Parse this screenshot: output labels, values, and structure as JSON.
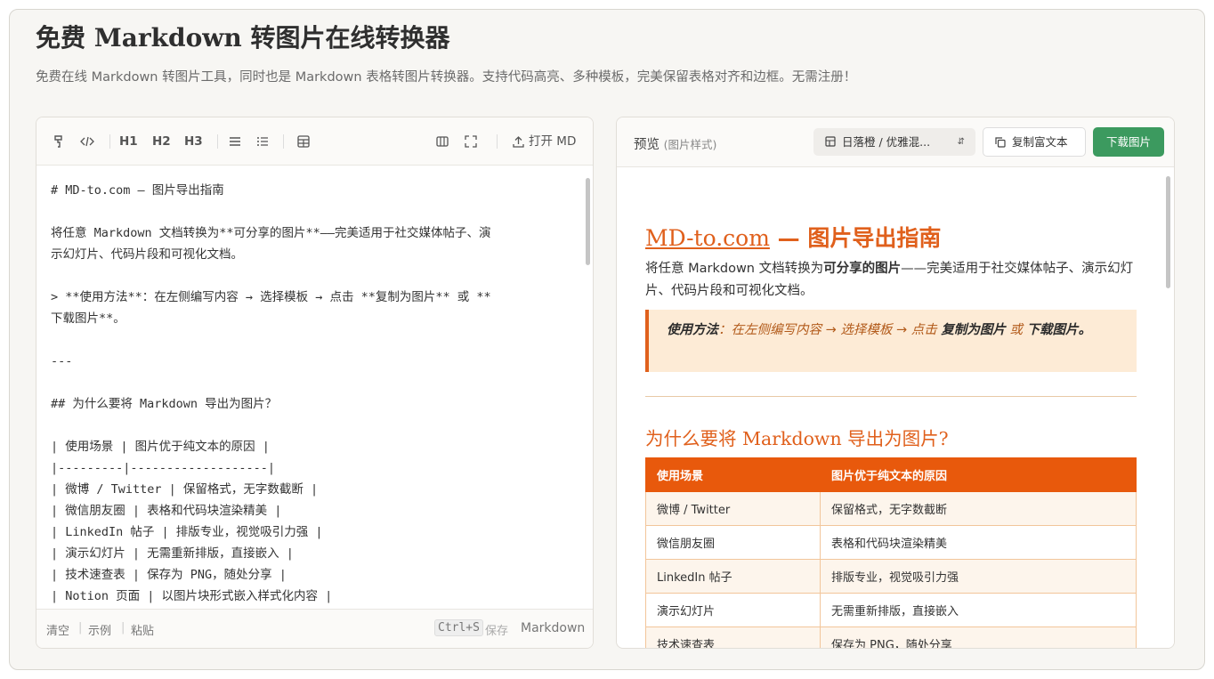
{
  "header": {
    "title": "免费 Markdown 转图片在线转换器",
    "subtitle": "免费在线 Markdown 转图片工具，同时也是 Markdown 表格转图片转换器。支持代码高亮、多种模板，完美保留表格对齐和边框。无需注册！"
  },
  "editor": {
    "toolbar": {
      "h1": "H1",
      "h2": "H2",
      "h3": "H3",
      "open_md": "打开 MD"
    },
    "lines": [
      "# MD-to.com — 图片导出指南",
      "",
      "将任意 Markdown 文档转换为**可分享的图片**——完美适用于社交媒体帖子、演",
      "示幻灯片、代码片段和可视化文档。",
      "",
      "> **使用方法**：在左侧编写内容 → 选择模板 → 点击 **复制为图片** 或 **",
      "下载图片**。",
      "",
      "---",
      "",
      "## 为什么要将 Markdown 导出为图片？",
      "",
      "| 使用场景 | 图片优于纯文本的原因 |",
      "|---------|-------------------|",
      "| 微博 / Twitter | 保留格式，无字数截断 |",
      "| 微信朋友圈 | 表格和代码块渲染精美 |",
      "| LinkedIn 帖子 | 排版专业，视觉吸引力强 |",
      "| 演示幻灯片 | 无需重新排版，直接嵌入 |",
      "| 技术速查表 | 保存为 PNG，随处分享 |",
      "| Notion 页面 | 以图片块形式嵌入样式化内容 |"
    ],
    "footer": {
      "clear": "清空",
      "example": "示例",
      "paste": "粘贴",
      "shortcut": "Ctrl+S",
      "save": "保存",
      "mode": "Markdown"
    }
  },
  "preview": {
    "label": "预览",
    "label_note": "(图片样式)",
    "template_select": "日落橙 / 优雅混...",
    "copy_button": "复制富文本",
    "download_button": "下载图片",
    "content": {
      "h1_link": "MD-to.com",
      "h1_rest": " — 图片导出指南",
      "para_a": "将任意 Markdown 文档转换为",
      "para_bold": "可分享的图片",
      "para_b": "——完美适用于社交媒体帖子、演示幻灯片、代码片段和可视化文档。",
      "quote_bold1": "使用方法",
      "quote_a": "：在左侧编写内容 → 选择模板 → 点击 ",
      "quote_bold2": "复制为图片",
      "quote_b": " 或 ",
      "quote_bold3": "下载图片",
      "quote_end": "。",
      "h2": "为什么要将 Markdown 导出为图片?",
      "table_headers": [
        "使用场景",
        "图片优于纯文本的原因"
      ],
      "table_rows": [
        [
          "微博 / Twitter",
          "保留格式，无字数截断"
        ],
        [
          "微信朋友圈",
          "表格和代码块渲染精美"
        ],
        [
          "LinkedIn 帖子",
          "排版专业，视觉吸引力强"
        ],
        [
          "演示幻灯片",
          "无需重新排版，直接嵌入"
        ],
        [
          "技术速查表",
          "保存为 PNG，随处分享"
        ]
      ]
    }
  },
  "colors": {
    "accent_orange": "#e0601c",
    "download_green": "#3c9a5f"
  }
}
